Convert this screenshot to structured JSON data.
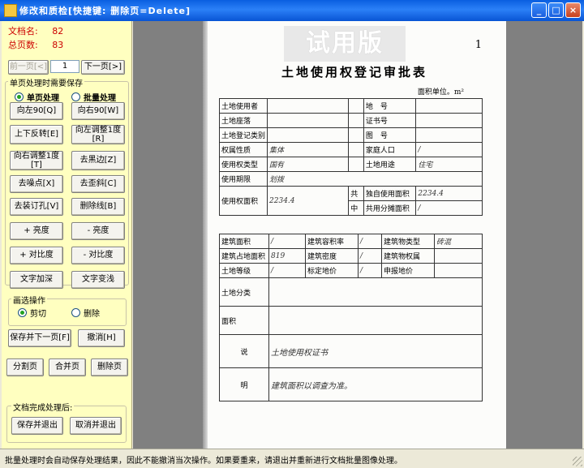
{
  "window": {
    "title": "修改和质检[快捷键: 删除页=Delete]"
  },
  "info": {
    "doc_name_label": "文档名:",
    "doc_name_value": "82",
    "total_pages_label": "总页数:",
    "total_pages_value": "83"
  },
  "nav": {
    "prev": "前一页[<]",
    "page": "1",
    "next": "下一页[>]"
  },
  "single_group": {
    "title": "单页处理时需要保存",
    "mode_single": "单页处理",
    "mode_batch": "批量处理",
    "buttons": [
      "向左90[Q]",
      "向右90[W]",
      "上下反转[E]",
      "向左调整1度\n[R]",
      "向右调整1度\n[T]",
      "去黑边[Z]",
      "去噪点[X]",
      "去歪斜[C]",
      "去装订孔[V]",
      "删除线[B]",
      "+ 亮度",
      "- 亮度",
      "+ 对比度",
      "- 对比度",
      "文字加深",
      "文字变浅"
    ]
  },
  "select_group": {
    "title": "画选操作",
    "cut": "剪切",
    "delete": "删除"
  },
  "save_next": "保存并下一页[F]",
  "undo": "撤消[H]",
  "split": "分割页",
  "merge": "合并页",
  "delete_page": "删除页",
  "done_group": {
    "title": "文档完成处理后:",
    "save_exit": "保存并退出",
    "cancel_exit": "取消并退出"
  },
  "status": "批量处理时会自动保存处理结果，因此不能撤消当次操作。如果要重来，请退出并重新进行文档批量图像处理。",
  "document": {
    "watermark": "试用版",
    "page_no": "1",
    "title": "土地使用权登记审批表",
    "unit": "面积单位。m²",
    "rows": [
      [
        "土地使用者",
        "",
        "地　号",
        ""
      ],
      [
        "土地座落",
        "",
        "证书号",
        ""
      ],
      [
        "土地登记类别",
        "",
        "图　号",
        ""
      ],
      [
        "权属性质",
        "集体",
        "家庭人口",
        "/"
      ],
      [
        "使用权类型",
        "国有",
        "土地用途",
        "住宅"
      ],
      [
        "使用期限",
        "划拨",
        "",
        ""
      ],
      [
        "使用权面积",
        "2234.4",
        "独自使用面积",
        "2234.4"
      ],
      [
        "",
        "",
        "共用分摊面积",
        "/"
      ]
    ],
    "build_rows": [
      [
        "建筑面积",
        "/",
        "建筑容积率",
        "/",
        "建筑物类型",
        "砖混"
      ],
      [
        "建筑占地面积",
        "819",
        "建筑密度",
        "/",
        "建筑物权属",
        ""
      ],
      [
        "土地等级",
        "/",
        "标定地价",
        "/",
        "申报地价",
        ""
      ]
    ],
    "share_label": "共",
    "share_label2": "中",
    "land_split": "土地分类",
    "area_label": "面积",
    "note_label": "说",
    "note_label2": "明",
    "note_text": "土地使用权证书",
    "handwritten": "建筑面积以调查为准。"
  }
}
